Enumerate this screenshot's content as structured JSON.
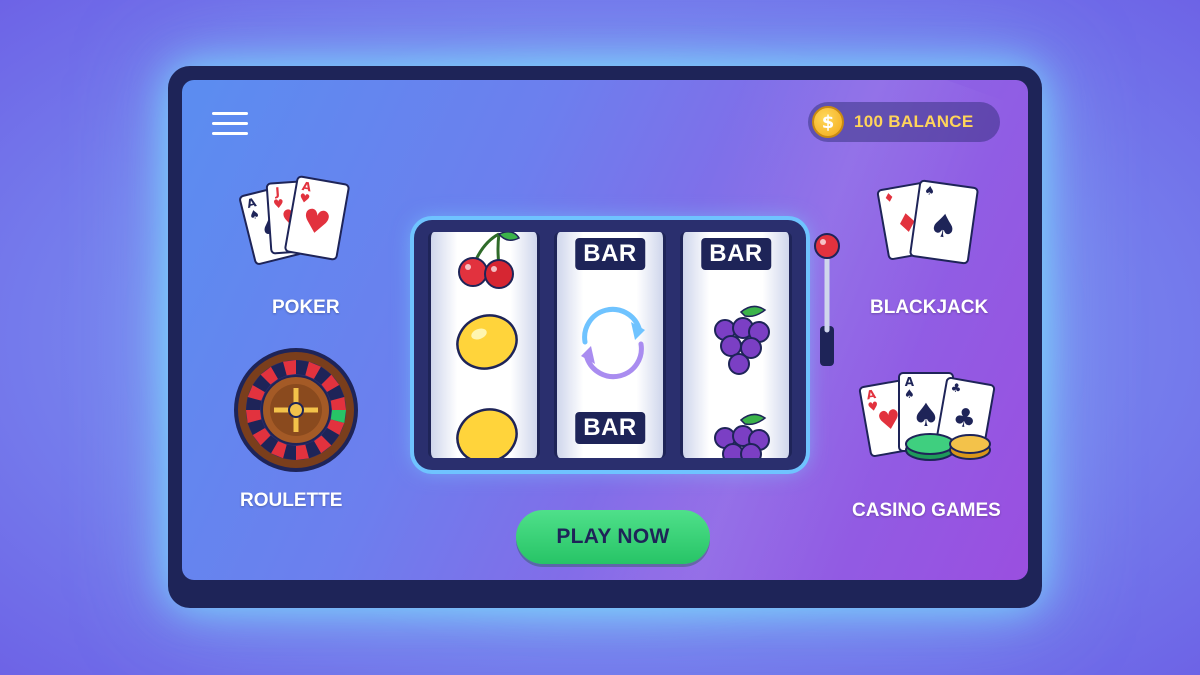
{
  "balance": {
    "amount_text": "100 BALANCE",
    "coin_symbol": "$"
  },
  "games": [
    {
      "id": "poker",
      "label": "POKER"
    },
    {
      "id": "blackjack",
      "label": "BLACKJACK"
    },
    {
      "id": "roulette",
      "label": "ROULETTE"
    },
    {
      "id": "casino_games",
      "label": "CASINO GAMES"
    }
  ],
  "slot": {
    "reels": [
      [
        "cherry-icon",
        "lemon-icon",
        "lemon-icon"
      ],
      [
        "BAR",
        "spin-arrows-icon",
        "BAR"
      ],
      [
        "BAR",
        "grapes-icon",
        "grapes-icon"
      ]
    ],
    "bar_label": "BAR"
  },
  "play_button": {
    "label": "PLAY NOW"
  },
  "colors": {
    "accent_green": "#27c466",
    "coin_gold": "#f3a91a",
    "balance_text": "#ffd45a",
    "frame_navy": "#1e2458",
    "card_red": "#e2323e"
  }
}
